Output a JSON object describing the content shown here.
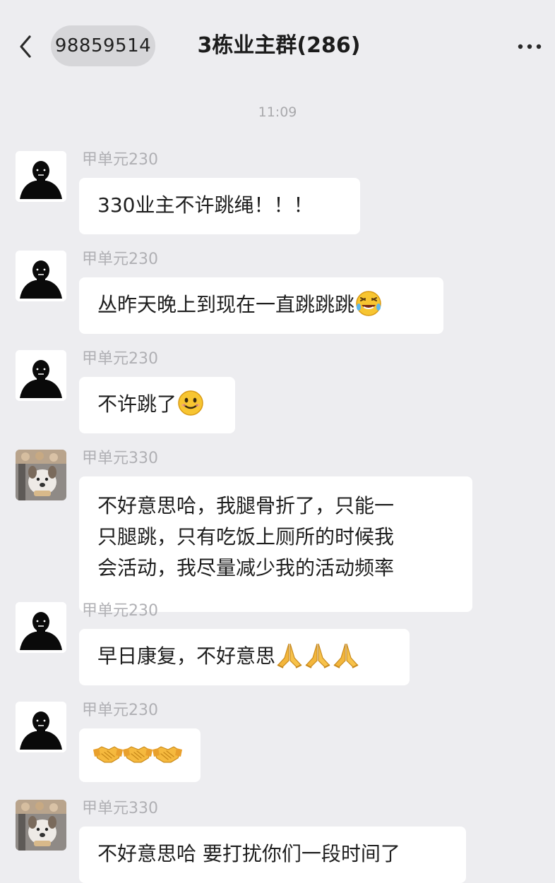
{
  "header": {
    "back_icon": "chevron-left-icon",
    "group_id": "98859514",
    "title": "3栋业主群(286)",
    "more_icon": "more-dots-icon"
  },
  "timestamp": "11:09",
  "messages": [
    {
      "sender": "甲单元230",
      "avatar": "silhouette-avatar",
      "lines": [
        "330业主不许跳绳！！！"
      ],
      "emoji": []
    },
    {
      "sender": "甲单元230",
      "avatar": "silhouette-avatar",
      "lines": [
        "丛昨天晚上到现在一直跳跳跳"
      ],
      "emoji": [
        "laughing-tears-emoji"
      ]
    },
    {
      "sender": "甲单元230",
      "avatar": "silhouette-avatar",
      "lines": [
        "不许跳了"
      ],
      "emoji": [
        "smile-emoji"
      ]
    },
    {
      "sender": "甲单元330",
      "avatar": "dog-photo-avatar",
      "lines": [
        "不好意思哈，我腿骨折了，只能一",
        "只腿跳，只有吃饭上厕所的时候我",
        "会活动，我尽量减少我的活动频率"
      ],
      "emoji": []
    },
    {
      "sender": "甲单元230",
      "avatar": "silhouette-avatar",
      "lines": [
        "早日康复，不好意思"
      ],
      "emoji": [
        "pray-emoji",
        "pray-emoji",
        "pray-emoji"
      ]
    },
    {
      "sender": "甲单元230",
      "avatar": "silhouette-avatar",
      "lines": [
        ""
      ],
      "emoji": [
        "handshake-emoji",
        "handshake-emoji",
        "handshake-emoji"
      ]
    },
    {
      "sender": "甲单元330",
      "avatar": "dog-photo-avatar",
      "lines": [
        "不好意思哈 要打扰你们一段时间了"
      ],
      "emoji": []
    }
  ]
}
